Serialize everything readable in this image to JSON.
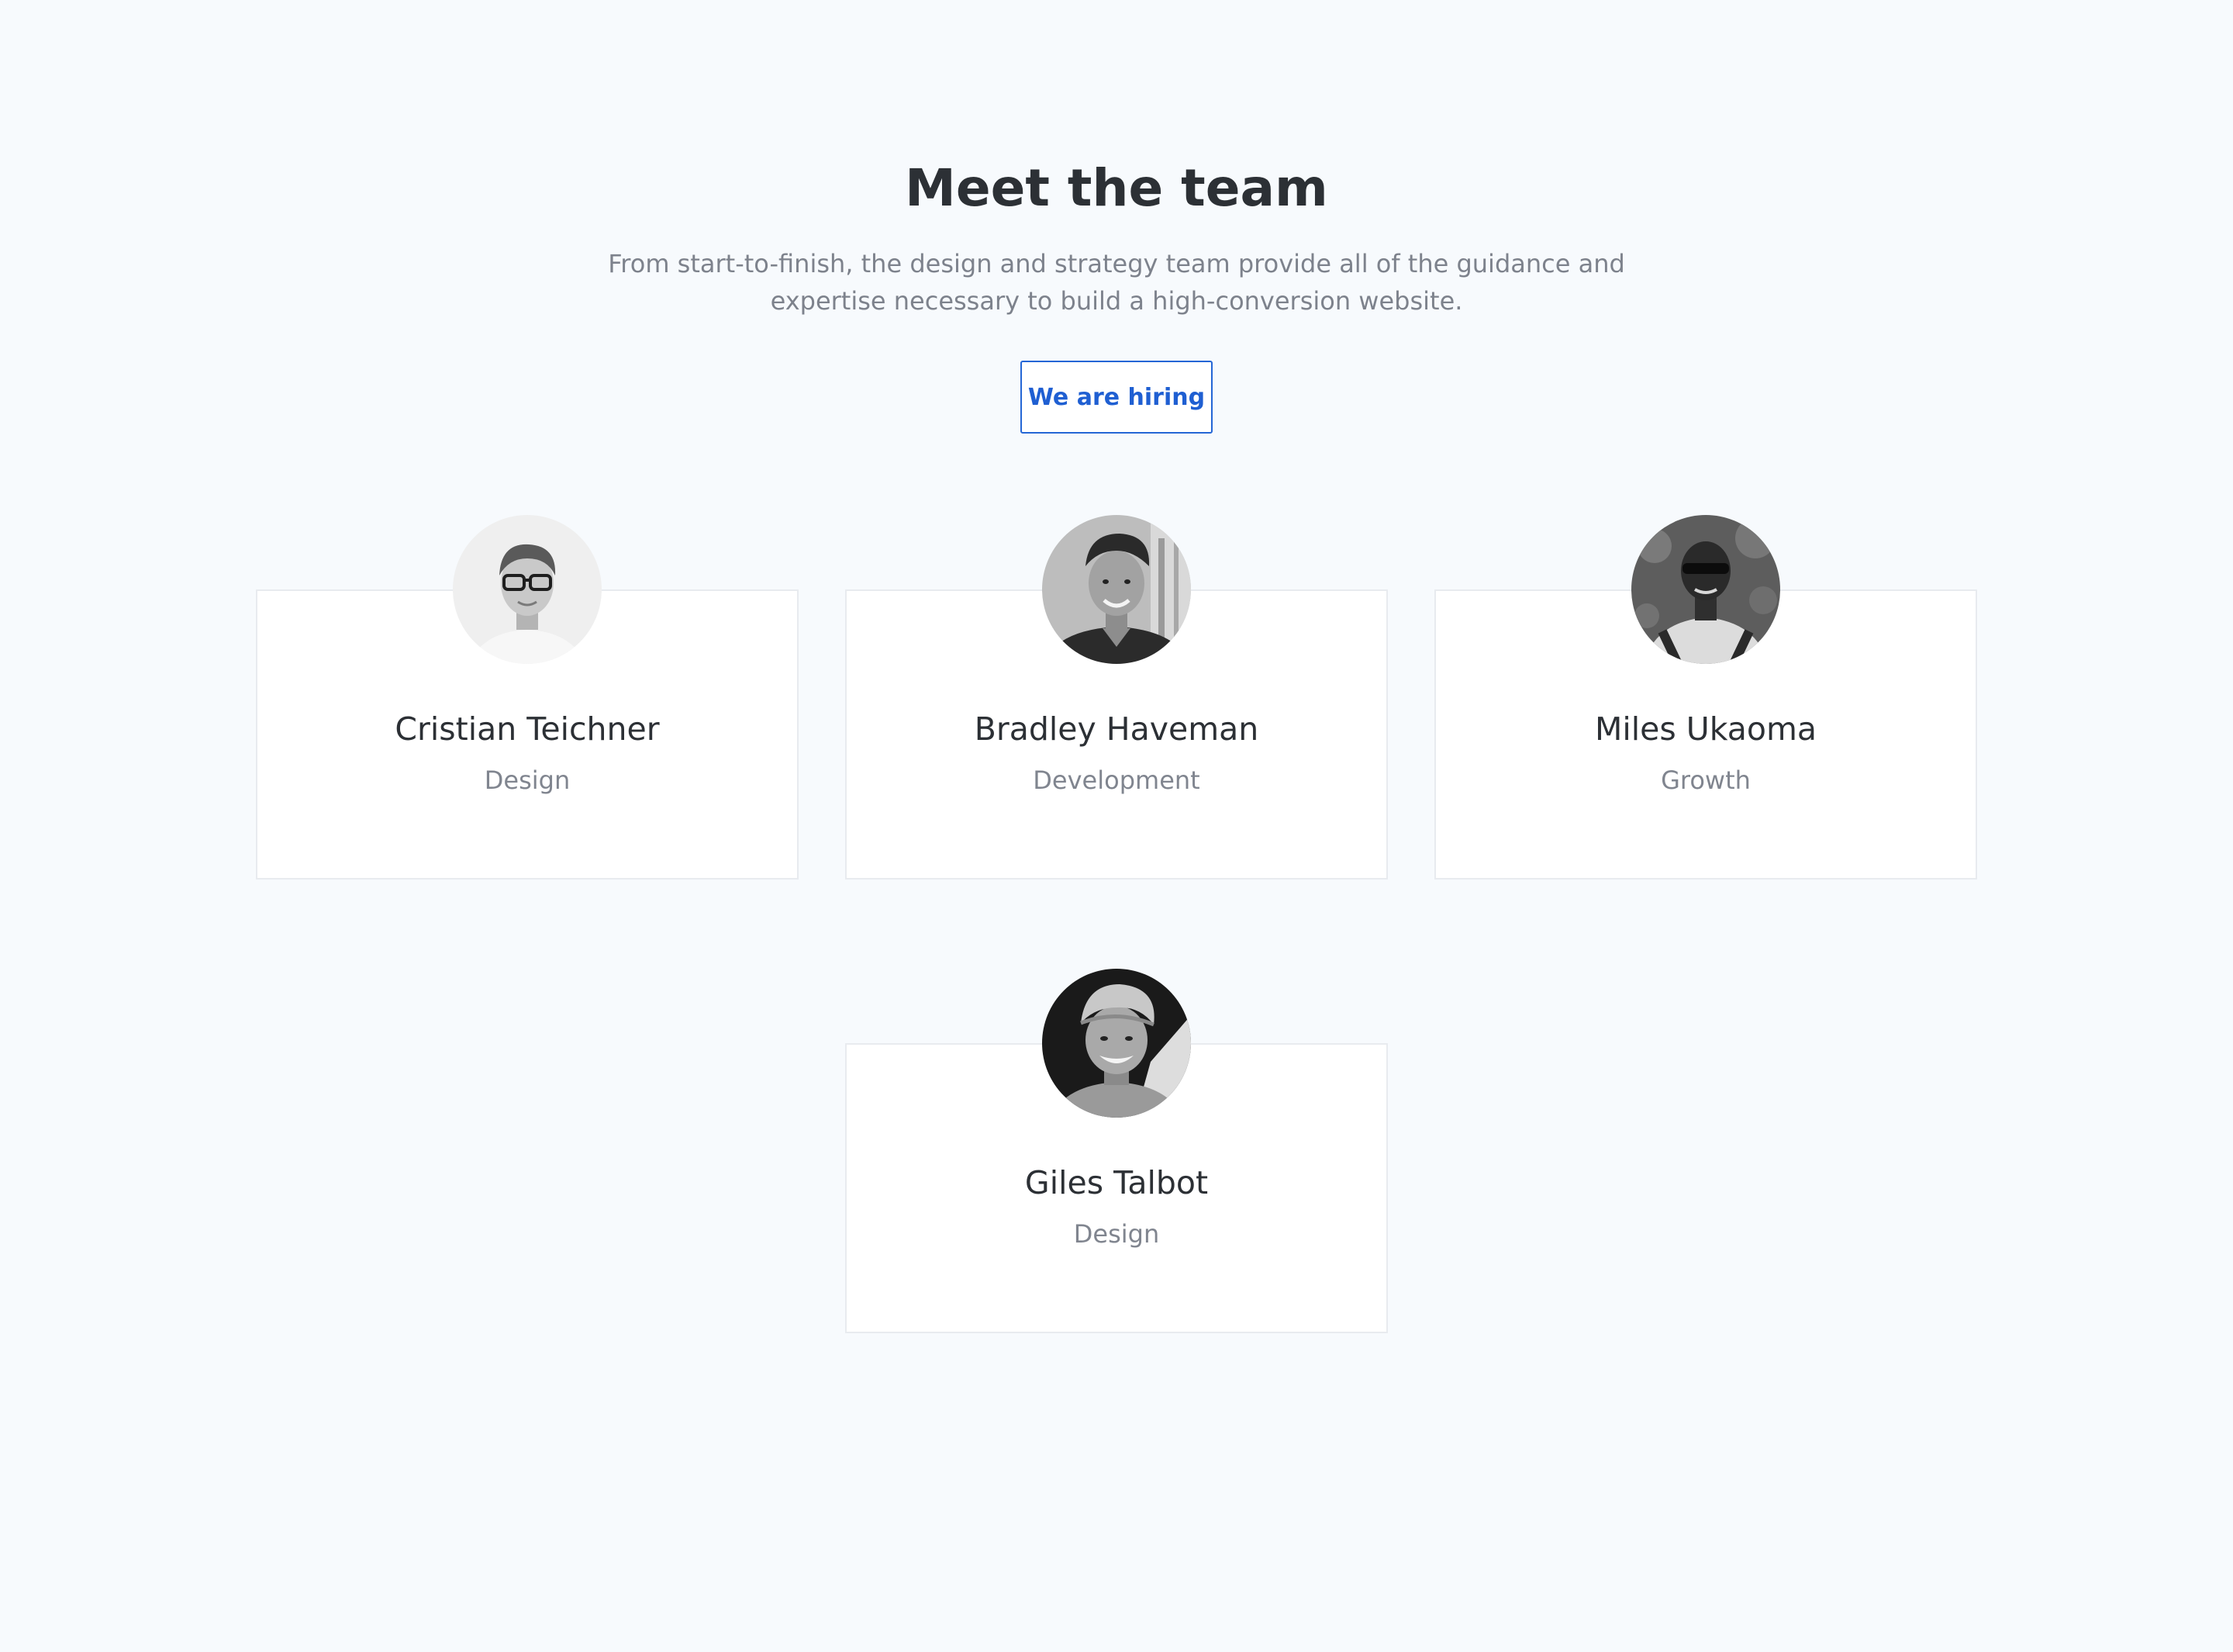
{
  "header": {
    "title": "Meet the team",
    "subtitle_line1": "From start-to-finish, the design and strategy team provide all of the guidance and",
    "subtitle_line2": "expertise necessary to build a high-conversion website.",
    "button_label": "We are hiring"
  },
  "team": [
    {
      "name": "Cristian Teichner",
      "role": "Design"
    },
    {
      "name": "Bradley Haveman",
      "role": "Development"
    },
    {
      "name": "Miles Ukaoma",
      "role": "Growth"
    },
    {
      "name": "Giles Talbot",
      "role": "Design"
    }
  ],
  "colors": {
    "background": "#f7fafd",
    "heading": "#2c3035",
    "muted": "#7d828c",
    "accent": "#2566d5",
    "card_border": "#e8ebef"
  }
}
